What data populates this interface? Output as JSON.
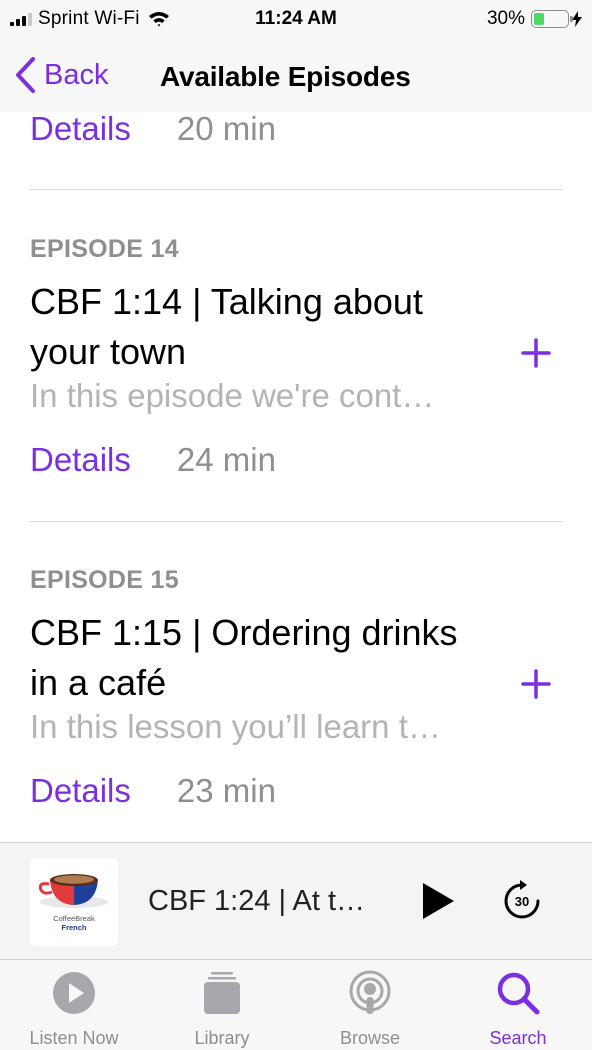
{
  "status_bar": {
    "carrier": "Sprint Wi-Fi",
    "time": "11:24 AM",
    "battery_percent": "30%",
    "battery_level": 0.3,
    "icons": [
      "signal-icon",
      "wifi-icon",
      "battery-icon",
      "charging-bolt-icon"
    ]
  },
  "nav": {
    "back_label": "Back",
    "title": "Available Episodes",
    "back_icon": "chevron-left-icon"
  },
  "partial_episode": {
    "details_label": "Details",
    "duration": "20 min"
  },
  "episodes": [
    {
      "label": "EPISODE 14",
      "title": "CBF 1:14 | Talking about your town",
      "description": "In this episode we're cont…",
      "details_label": "Details",
      "duration": "24 min",
      "add_icon": "plus-icon"
    },
    {
      "label": "EPISODE 15",
      "title": "CBF 1:15 | Ordering drinks in a café",
      "description": "In this lesson you’ll learn t…",
      "details_label": "Details",
      "duration": "23 min",
      "add_icon": "plus-icon"
    }
  ],
  "now_playing": {
    "title": "CBF 1:24 | At t…",
    "artwork_brand": "CoffeeBreak",
    "artwork_language": "French",
    "play_icon": "play-icon",
    "skip_icon": "skip-forward-30-icon",
    "skip_seconds": "30"
  },
  "tabs": [
    {
      "label": "Listen Now",
      "icon": "play-circle-icon",
      "active": false
    },
    {
      "label": "Library",
      "icon": "library-icon",
      "active": false
    },
    {
      "label": "Browse",
      "icon": "podcast-icon",
      "active": false
    },
    {
      "label": "Search",
      "icon": "search-icon",
      "active": true
    }
  ],
  "colors": {
    "accent": "#7b2fe0",
    "secondary_text": "#8e8e93",
    "description_text": "#b3b3b8",
    "battery_fill": "#4cd964"
  }
}
